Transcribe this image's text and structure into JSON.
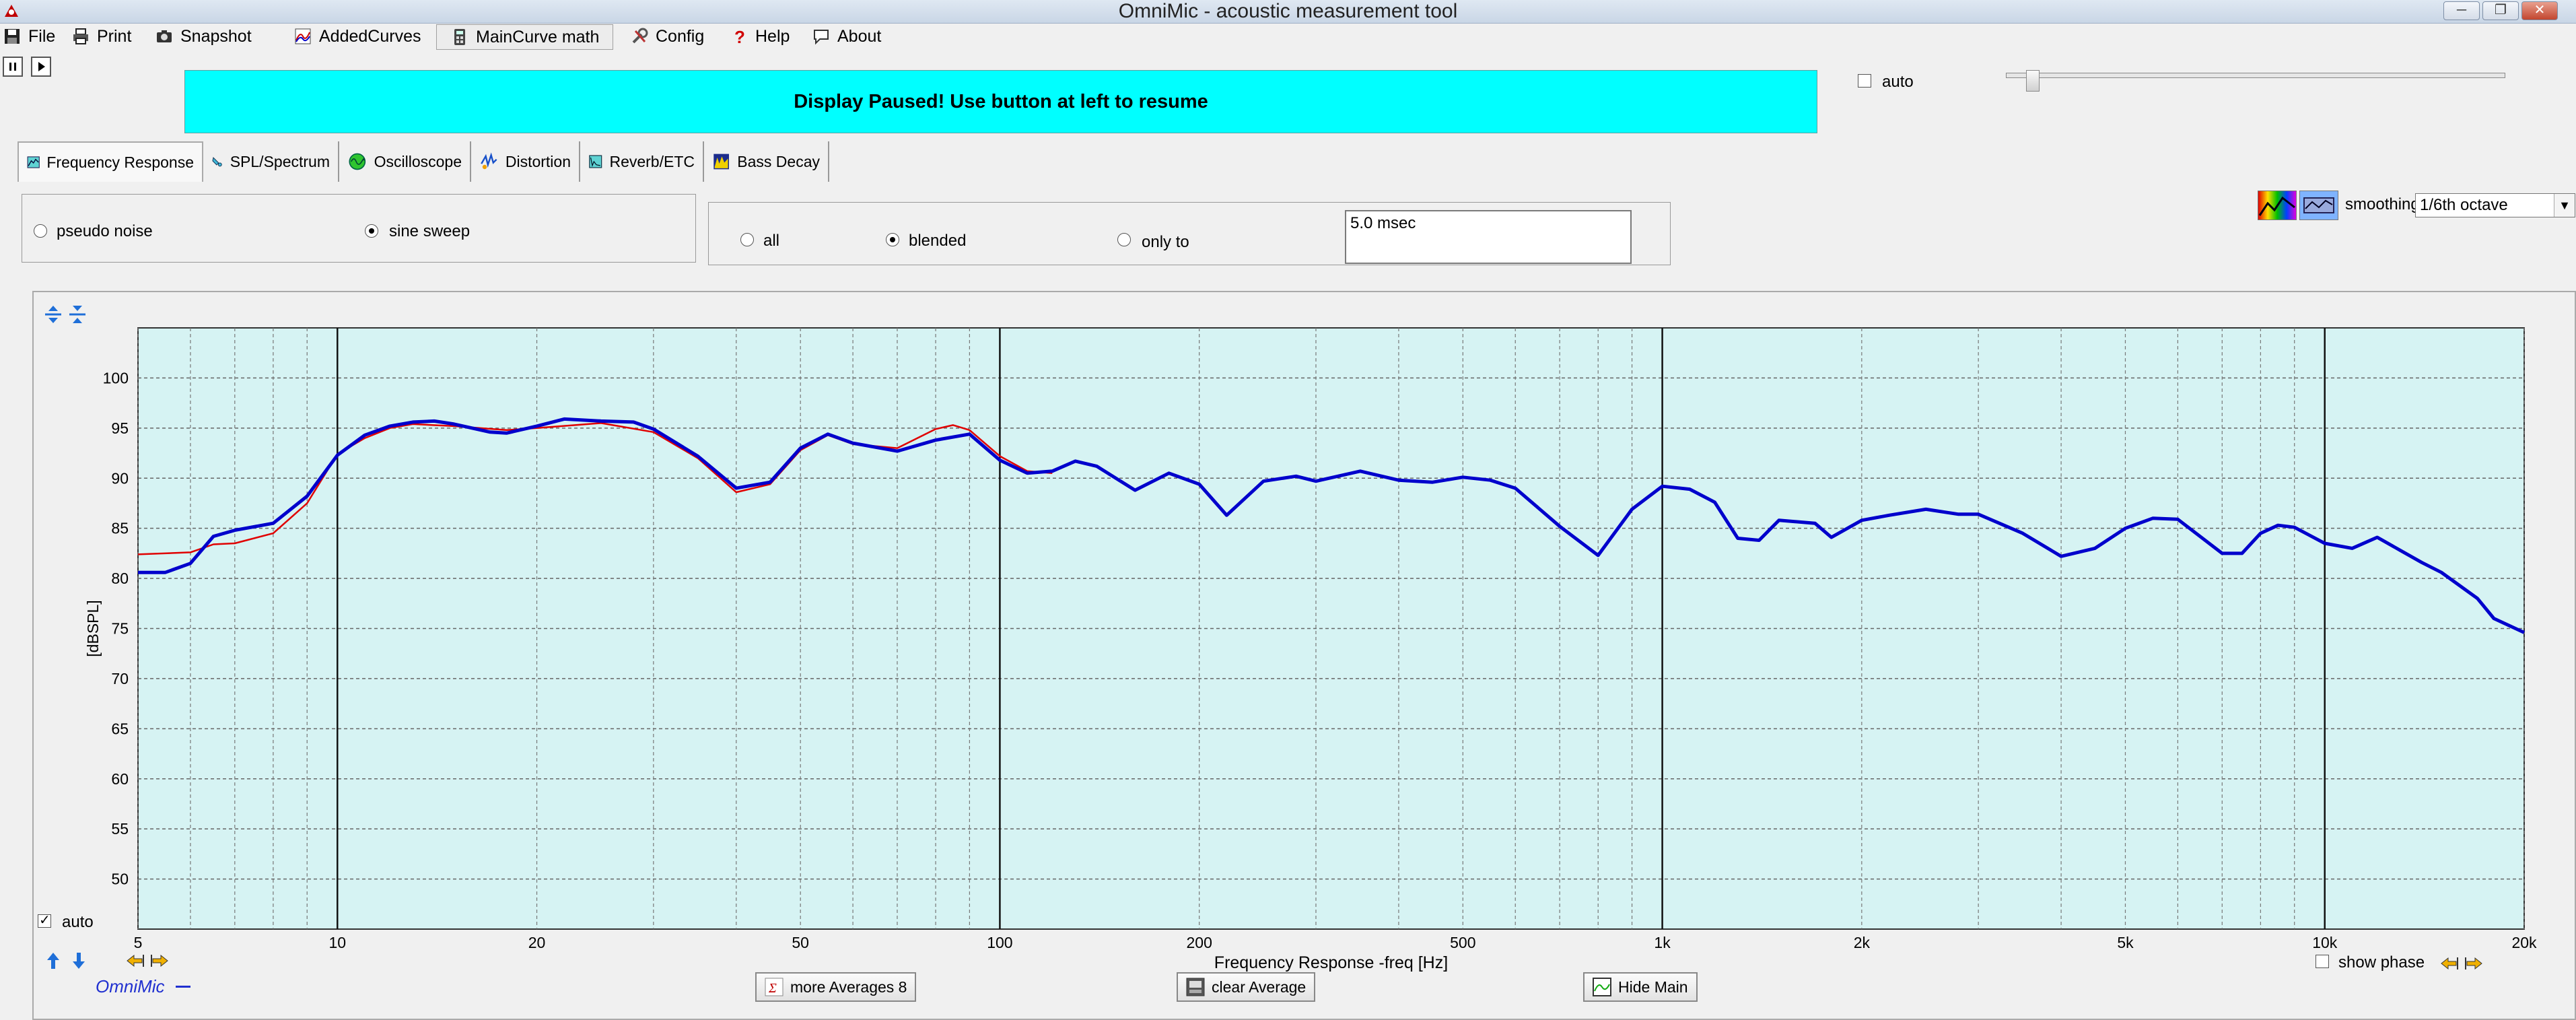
{
  "window": {
    "title": "OmniMic - acoustic measurement tool"
  },
  "menu": {
    "file": "File",
    "print": "Print",
    "snapshot": "Snapshot",
    "added_curves": "AddedCurves",
    "maincurve_math": "MainCurve math",
    "config": "Config",
    "help": "Help",
    "about": "About"
  },
  "banner": {
    "message": "Display Paused! Use button at left to resume",
    "color": "#00ffff"
  },
  "top_controls": {
    "auto_label": "auto",
    "auto_checked": false
  },
  "tabs": [
    {
      "label": "Frequency Response",
      "icon": "frequency-response-icon",
      "active": true
    },
    {
      "label": "SPL/Spectrum",
      "icon": "spl-spectrum-icon",
      "active": false
    },
    {
      "label": "Oscilloscope",
      "icon": "oscilloscope-icon",
      "active": false
    },
    {
      "label": "Distortion",
      "icon": "distortion-icon",
      "active": false
    },
    {
      "label": "Reverb/ETC",
      "icon": "reverb-etc-icon",
      "active": false
    },
    {
      "label": "Bass Decay",
      "icon": "bass-decay-icon",
      "active": false
    }
  ],
  "signal": {
    "pseudo_noise": "pseudo noise",
    "sine_sweep": "sine sweep",
    "selected": "sine sweep"
  },
  "window_mode": {
    "all": "all",
    "blended": "blended",
    "only_to": "only to",
    "selected": "blended",
    "time_value": "5.0 msec"
  },
  "smoothing": {
    "label": "smoothing",
    "value": "1/6th octave"
  },
  "graph": {
    "auto_label": "auto",
    "auto_checked": true,
    "show_phase_label": "show phase",
    "show_phase_checked": false,
    "brand_label": "OmniMic",
    "plot_bg": "#d6f3f3",
    "main_color": "#0000cc",
    "ref_color": "#e00000"
  },
  "buttons": {
    "more_averages": "more Averages 8",
    "clear_average": "clear Average",
    "hide_main": "Hide Main"
  },
  "chart_data": {
    "type": "line",
    "xlabel": "Frequency Response -freq [Hz]",
    "ylabel": "[dBSPL]",
    "xscale": "log",
    "xlim": [
      5,
      20000
    ],
    "ylim": [
      45,
      105
    ],
    "xticks": [
      {
        "v": 5,
        "label": "5"
      },
      {
        "v": 10,
        "label": "10"
      },
      {
        "v": 20,
        "label": "20"
      },
      {
        "v": 50,
        "label": "50"
      },
      {
        "v": 100,
        "label": "100"
      },
      {
        "v": 200,
        "label": "200"
      },
      {
        "v": 500,
        "label": "500"
      },
      {
        "v": 1000,
        "label": "1k"
      },
      {
        "v": 2000,
        "label": "2k"
      },
      {
        "v": 5000,
        "label": "5k"
      },
      {
        "v": 10000,
        "label": "10k"
      },
      {
        "v": 20000,
        "label": "20k"
      }
    ],
    "yticks": [
      50,
      55,
      60,
      65,
      70,
      75,
      80,
      85,
      90,
      95,
      100
    ],
    "grid": true,
    "series": [
      {
        "x": [
          5,
          5.5,
          6,
          6.5,
          7,
          8,
          9,
          10,
          11,
          12,
          13,
          14,
          15,
          17,
          18,
          20,
          22,
          25,
          28,
          30,
          35,
          40,
          45,
          50,
          55,
          60,
          70,
          80,
          90,
          100,
          110,
          120,
          130,
          140,
          160,
          180,
          200,
          220,
          250,
          280,
          300,
          350,
          400,
          450,
          500,
          550,
          600,
          700,
          800,
          900,
          1000,
          1100,
          1200,
          1300,
          1400,
          1500,
          1700,
          1800,
          2000,
          2200,
          2500,
          2800,
          3000,
          3500,
          4000,
          4500,
          5000,
          5500,
          6000,
          7000,
          7500,
          8000,
          8500,
          9000,
          10000,
          11000,
          12000,
          13000,
          14000,
          15000,
          17000,
          18000,
          20000
        ],
        "y": [
          80.6,
          80.6,
          81.5,
          84.2,
          84.8,
          85.5,
          88.2,
          92.3,
          94.3,
          95.2,
          95.6,
          95.7,
          95.4,
          94.6,
          94.5,
          95.2,
          95.9,
          95.7,
          95.6,
          94.9,
          92.2,
          89.0,
          89.6,
          93.0,
          94.4,
          93.5,
          92.7,
          93.8,
          94.4,
          91.8,
          90.5,
          90.7,
          91.7,
          91.2,
          88.8,
          90.5,
          89.4,
          86.3,
          89.7,
          90.2,
          89.7,
          90.7,
          89.8,
          89.6,
          90.1,
          89.8,
          89.0,
          85.2,
          82.3,
          86.9,
          89.2,
          88.9,
          87.6,
          84.0,
          83.8,
          85.8,
          85.5,
          84.1,
          85.8,
          86.3,
          86.9,
          86.4,
          86.4,
          84.5,
          82.2,
          83.0,
          85.0,
          86.0,
          85.9,
          82.5,
          82.5,
          84.5,
          85.3,
          85.1,
          83.5,
          83.0,
          84.1,
          82.8,
          81.6,
          80.6,
          78.0,
          76.0,
          74.6
        ]
      },
      {
        "x": [
          5,
          6,
          6.5,
          7,
          8,
          9,
          10,
          11,
          12,
          13,
          15,
          18,
          20,
          25,
          30,
          35,
          40,
          45,
          50,
          55,
          60,
          70,
          80,
          85,
          90,
          100,
          110,
          120
        ],
        "y": [
          82.4,
          82.6,
          83.4,
          83.5,
          84.5,
          87.5,
          92.4,
          94.0,
          95.0,
          95.4,
          95.2,
          94.8,
          95.0,
          95.5,
          94.6,
          92.0,
          88.6,
          89.4,
          92.8,
          94.3,
          93.4,
          93.0,
          94.9,
          95.3,
          94.8,
          92.2,
          90.7,
          90.5
        ]
      }
    ]
  }
}
